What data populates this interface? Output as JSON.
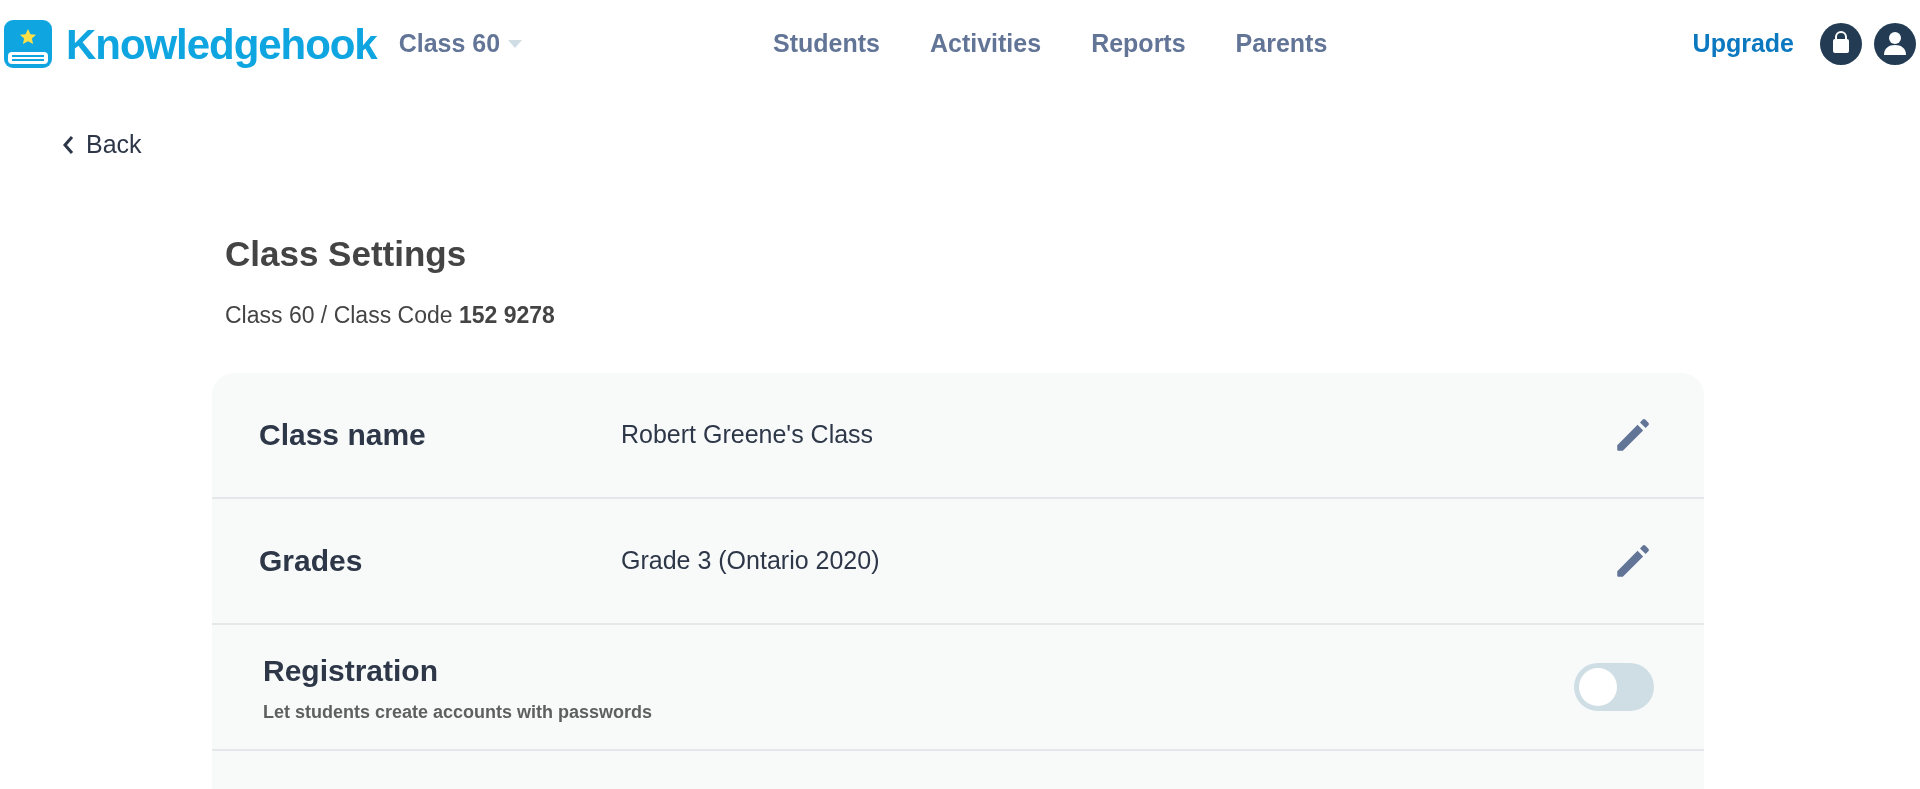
{
  "header": {
    "brand": "Knowledgehook",
    "class_selector": "Class 60",
    "nav": [
      "Students",
      "Activities",
      "Reports",
      "Parents"
    ],
    "upgrade": "Upgrade"
  },
  "back": "Back",
  "title": "Class Settings",
  "subtitle": "Class 60 / Class Code **152 9278**",
  "settings": [
    {
      "kind": "edit",
      "label": "Class name",
      "value": "Robert Greene's Class"
    },
    {
      "kind": "edit",
      "label": "Grades",
      "value": "Grade 3 (Ontario 2020)"
    },
    {
      "kind": "toggle",
      "label": "Registration",
      "description": "Let students create accounts with passwords",
      "on": false
    }
  ]
}
